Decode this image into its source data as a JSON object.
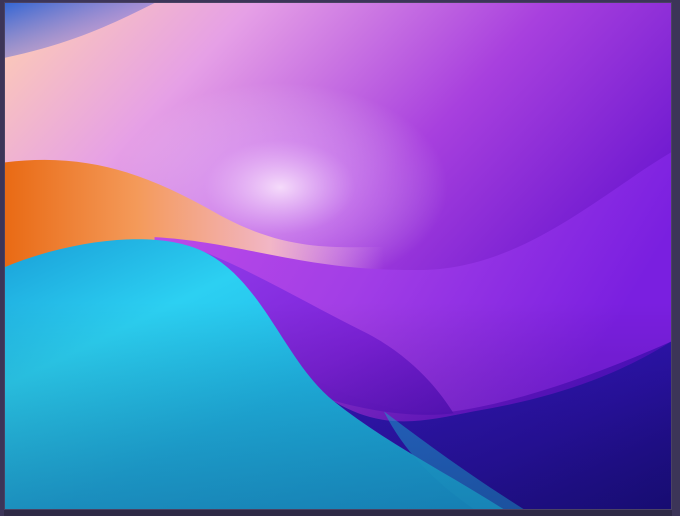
{
  "image": {
    "subject": "abstract-wave-wallpaper",
    "palette": {
      "frame": "#3c3558",
      "deep_violet": "#4a12c8",
      "violet": "#8a2be2",
      "magenta": "#b04ae8",
      "orange": "#f07a2a",
      "peach": "#ffc9a6",
      "cyan": "#22c6ea",
      "teal": "#18a7d6",
      "indigo": "#2d1ca8"
    }
  }
}
